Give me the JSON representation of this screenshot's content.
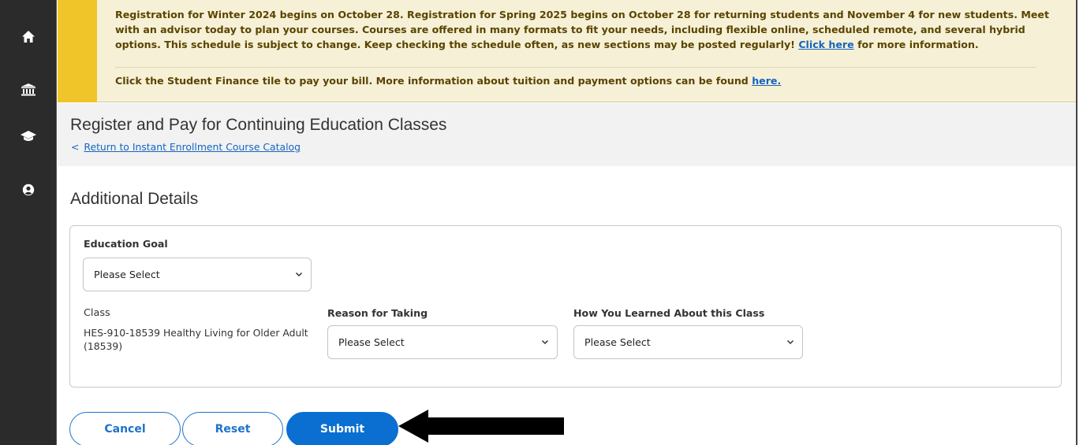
{
  "sidebar": {
    "items": [
      {
        "icon": "home-icon"
      },
      {
        "icon": "bank-icon"
      },
      {
        "icon": "graduation-cap-icon"
      },
      {
        "icon": "user-circle-icon"
      }
    ]
  },
  "banner": {
    "line1_before": "Registration for Winter 2024 begins on October 28. Registration for Spring 2025 begins on October 28 for returning students and November 4 for new students. Meet with an advisor today to plan your courses. Courses are offered in many formats to fit your needs, including flexible online, scheduled remote, and several hybrid options. This schedule is subject to change. Keep checking the schedule often, as new sections may be posted regularly! ",
    "line1_link": "Click here",
    "line1_after": " for more information.",
    "line2_before": "Click the Student Finance tile to pay your bill. More information about tuition and payment options can be found ",
    "line2_link": "here.",
    "accent_color": "#f0c52a"
  },
  "header": {
    "title": "Register and Pay for Continuing Education Classes",
    "back_chevron": "<",
    "back_link": "Return to Instant Enrollment Course Catalog"
  },
  "main": {
    "section_title": "Additional Details",
    "education_goal": {
      "label": "Education Goal",
      "value": "Please Select"
    },
    "class": {
      "label": "Class",
      "value": "HES-910-18539 Healthy Living for Older Adult (18539)"
    },
    "reason": {
      "label": "Reason for Taking",
      "value": "Please Select"
    },
    "how_learned": {
      "label": "How You Learned About this Class",
      "value": "Please Select"
    }
  },
  "actions": {
    "cancel": "Cancel",
    "reset": "Reset",
    "submit": "Submit",
    "primary_color": "#0a6fd1"
  }
}
